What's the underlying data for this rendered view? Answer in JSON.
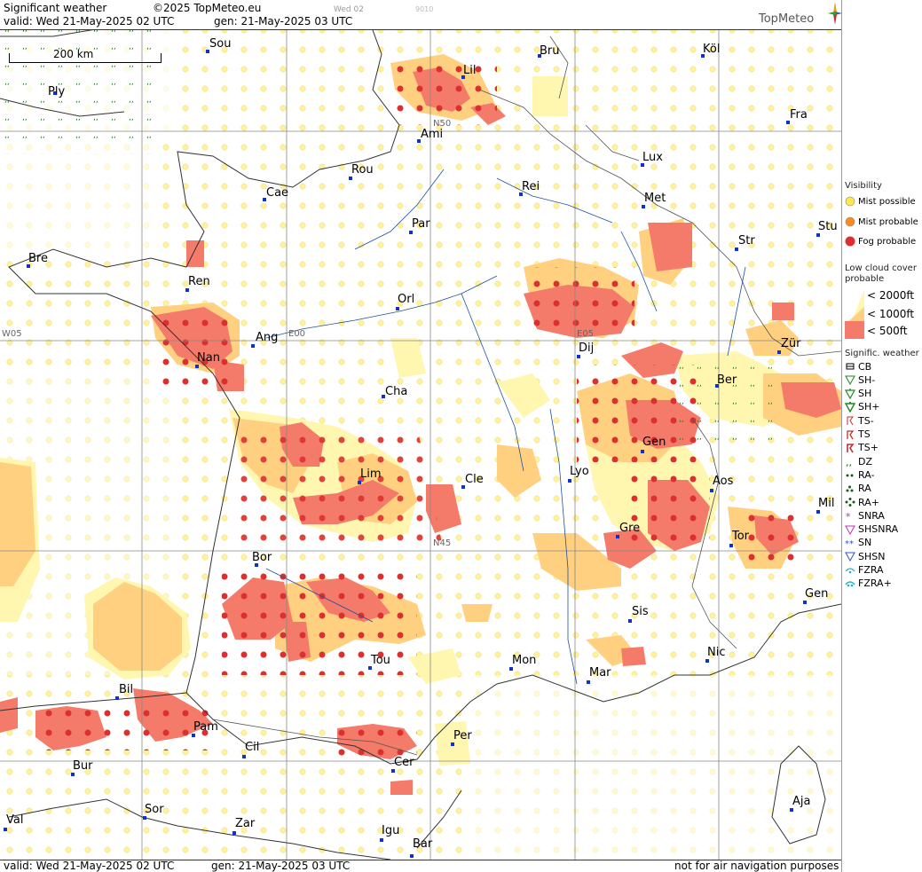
{
  "header": {
    "title": "Significant weather",
    "copyright": "©2025 TopMeteo.eu",
    "valid": "valid:  Wed  21-May-2025  02 UTC",
    "gen": "gen: 21-May-2025 03 UTC",
    "tab_day": "Wed 02",
    "tab_code": "9010",
    "brand": "TopMeteo"
  },
  "scale": {
    "label": "200 km"
  },
  "grid_labels": {
    "n50": "N50",
    "n45": "N45",
    "w05": "W05",
    "e00": "E00",
    "e05": "E05"
  },
  "cities": [
    {
      "name": "Sou"
    },
    {
      "name": "Bru"
    },
    {
      "name": "Köl"
    },
    {
      "name": "Lil"
    },
    {
      "name": "Ply"
    },
    {
      "name": "Ami"
    },
    {
      "name": "Fra"
    },
    {
      "name": "Lux"
    },
    {
      "name": "Rou"
    },
    {
      "name": "Cae"
    },
    {
      "name": "Rei"
    },
    {
      "name": "Met"
    },
    {
      "name": "Par"
    },
    {
      "name": "Bre"
    },
    {
      "name": "Stu"
    },
    {
      "name": "Str"
    },
    {
      "name": "Ren"
    },
    {
      "name": "Orl"
    },
    {
      "name": "Ang"
    },
    {
      "name": "Dij"
    },
    {
      "name": "Zür"
    },
    {
      "name": "Nan"
    },
    {
      "name": "Cha"
    },
    {
      "name": "Ber"
    },
    {
      "name": "Gen"
    },
    {
      "name": "Lim"
    },
    {
      "name": "Cle"
    },
    {
      "name": "Lyo"
    },
    {
      "name": "Aos"
    },
    {
      "name": "Mil"
    },
    {
      "name": "Gre"
    },
    {
      "name": "Tor"
    },
    {
      "name": "Bor"
    },
    {
      "name": "Gen"
    },
    {
      "name": "Sis"
    },
    {
      "name": "Tou"
    },
    {
      "name": "Mon"
    },
    {
      "name": "Mar"
    },
    {
      "name": "Nic"
    },
    {
      "name": "Bil"
    },
    {
      "name": "Pam"
    },
    {
      "name": "Cil"
    },
    {
      "name": "Per"
    },
    {
      "name": "Bur"
    },
    {
      "name": "Cer"
    },
    {
      "name": "Sor"
    },
    {
      "name": "Aja"
    },
    {
      "name": "Val"
    },
    {
      "name": "Zar"
    },
    {
      "name": "Igu"
    },
    {
      "name": "Bar"
    }
  ],
  "legend": {
    "visibility_title": "Visibility",
    "mist_possible": "Mist possible",
    "mist_probable": "Mist probable",
    "fog_probable": "Fog probable",
    "low_cloud_title": "Low cloud cover probable",
    "lc_2000": "< 2000ft",
    "lc_1000": "< 1000ft",
    "lc_500": "<   500ft",
    "signific_title": "Signific. weather",
    "cb": "CB",
    "sh_minus": "SH-",
    "sh": "SH",
    "sh_plus": "SH+",
    "ts_minus": "TS-",
    "ts": "TS",
    "ts_plus": "TS+",
    "dz": "DZ",
    "ra_minus": "RA-",
    "ra": "RA",
    "ra_plus": "RA+",
    "snra": "SNRA",
    "shsnra": "SHSNRA",
    "sn": "SN",
    "shsn": "SHSN",
    "fzra": "FZRA",
    "fzra_plus": "FZRA+"
  },
  "colors": {
    "cloud_2000": "#fff6b0",
    "cloud_1000": "#ffd080",
    "cloud_500": "#f47a6a",
    "mist_possible": "#ffe84a",
    "mist_probable": "#ff8a1e",
    "fog_probable": "#dc3030",
    "city_marker": "#1030d0",
    "drizzle": "#1a7a1a"
  },
  "footer": {
    "valid": "valid:  Wed  21-May-2025  02 UTC",
    "gen": "gen: 21-May-2025 03 UTC",
    "disclaimer": "not for air navigation purposes"
  }
}
